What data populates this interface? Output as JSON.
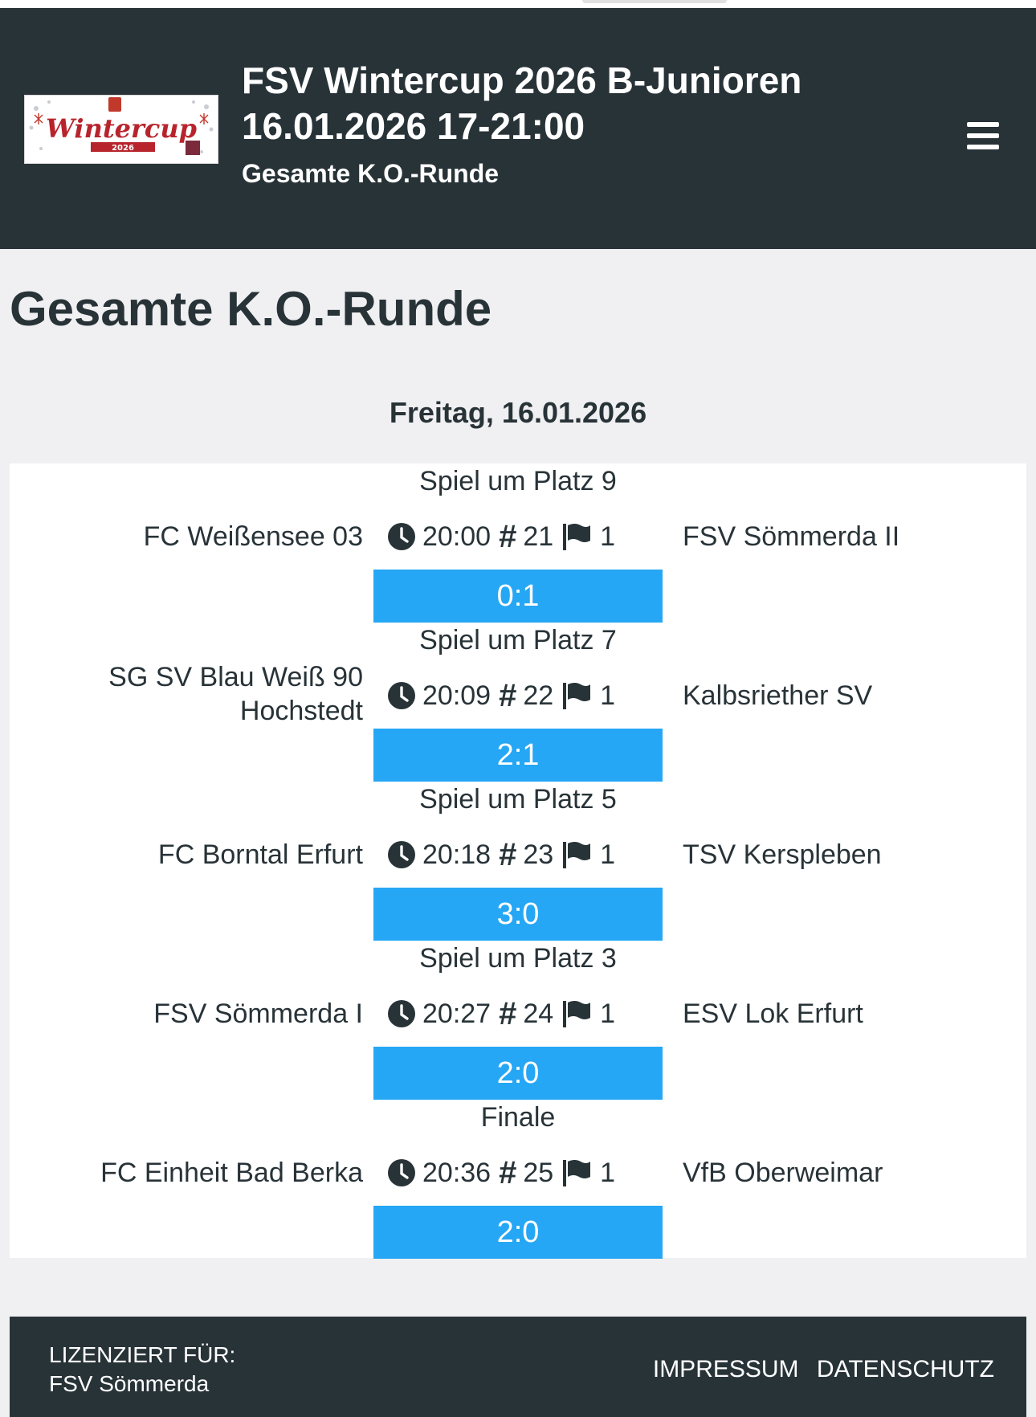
{
  "header": {
    "logo_text": "Wintercup",
    "logo_year": "2026",
    "title": "FSV Wintercup 2026 B-Junioren",
    "datetime": "16.01.2026 17-21:00",
    "subtitle": "Gesamte K.O.-Runde"
  },
  "page": {
    "title": "Gesamte K.O.-Runde",
    "date_heading": "Freitag, 16.01.2026"
  },
  "matches": [
    {
      "round": "Spiel um Platz 9",
      "home": "FC Weißensee 03",
      "time": "20:00",
      "game_no": "21",
      "field": "1",
      "away": "FSV Sömmerda II",
      "score": "0:1"
    },
    {
      "round": "Spiel um Platz 7",
      "home": "SG SV Blau Weiß 90 Hochstedt",
      "time": "20:09",
      "game_no": "22",
      "field": "1",
      "away": "Kalbsriether SV",
      "score": "2:1"
    },
    {
      "round": "Spiel um Platz 5",
      "home": "FC Borntal Erfurt",
      "time": "20:18",
      "game_no": "23",
      "field": "1",
      "away": "TSV Kerspleben",
      "score": "3:0"
    },
    {
      "round": "Spiel um Platz 3",
      "home": "FSV Sömmerda I",
      "time": "20:27",
      "game_no": "24",
      "field": "1",
      "away": "ESV Lok Erfurt",
      "score": "2:0"
    },
    {
      "round": "Finale",
      "home": "FC Einheit Bad Berka",
      "time": "20:36",
      "game_no": "25",
      "field": "1",
      "away": "VfB Oberweimar",
      "score": "2:0"
    }
  ],
  "icons": {
    "time": "clock-icon",
    "game_no": "hash-icon",
    "field": "flag-icon",
    "menu": "hamburger-menu-icon"
  },
  "colors": {
    "header_bg": "#283338",
    "score_bg": "#26a7f5",
    "page_bg": "#f0f0f2"
  },
  "footer": {
    "licensed_label": "LIZENZIERT FÜR:",
    "licensed_to": "FSV Sömmerda",
    "impressum": "IMPRESSUM",
    "datenschutz": "DATENSCHUTZ"
  }
}
